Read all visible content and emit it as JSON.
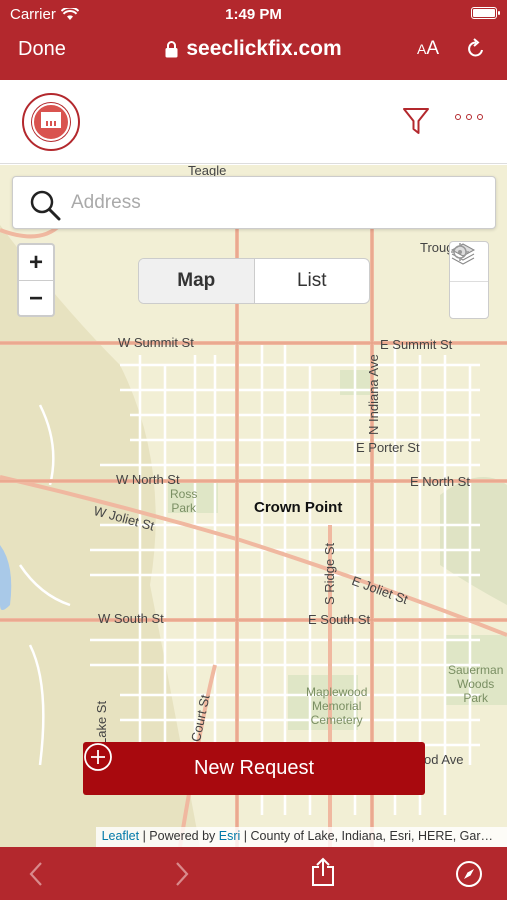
{
  "status_bar": {
    "carrier": "Carrier",
    "time": "1:49 PM"
  },
  "browser": {
    "done_label": "Done",
    "url": "seeclickfix.com",
    "text_size_label_small": "A",
    "text_size_label_large": "A"
  },
  "search": {
    "placeholder": "Address",
    "value": ""
  },
  "zoom": {
    "in_label": "+",
    "out_label": "−"
  },
  "view_toggle": {
    "map_label": "Map",
    "list_label": "List",
    "selected": "Map"
  },
  "new_request": {
    "label": "New Request"
  },
  "attribution": {
    "leaflet": "Leaflet",
    "powered_by": " | Powered by ",
    "esri": "Esri",
    "rest": " | County of Lake, Indiana, Esri, HERE, Gar…"
  },
  "map_labels": {
    "city": "Crown Point",
    "w_summit": "W Summit St",
    "e_summit": "E Summit St",
    "w_north": "W North St",
    "e_north": "E North St",
    "e_porter": "E Porter St",
    "w_joliet": "W Joliet St",
    "e_joliet": "E Joliet St",
    "w_south": "W South St",
    "e_south": "E South St",
    "n_indiana": "N Indiana Ave",
    "s_ridge": "S Ridge St",
    "court": "Court St",
    "lake": "Lake St",
    "od_ave": "od Ave",
    "troug": "Troug",
    "teagle": "Teagle",
    "ross_park_1": "Ross",
    "ross_park_2": "Park",
    "maplewood_1": "Maplewood",
    "maplewood_2": "Memorial",
    "maplewood_3": "Cemetery",
    "sauerman_1": "Sauerman",
    "sauerman_2": "Woods",
    "sauerman_3": "Park"
  },
  "colors": {
    "brand": "#b3282d",
    "new_request_bg": "#a8090e",
    "map_bg": "#f2efd5",
    "road": "#f0b8a0"
  }
}
